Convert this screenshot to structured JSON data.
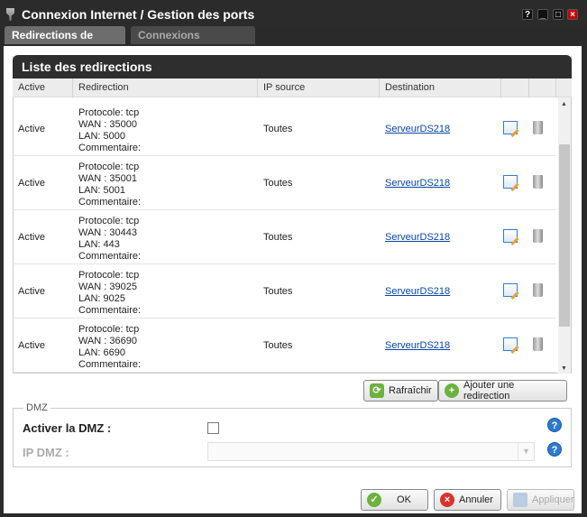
{
  "window": {
    "title": "Connexion Internet / Gestion des ports",
    "help": "?"
  },
  "tabs": [
    "Redirections de ports",
    "Connexions entrantes"
  ],
  "panel": {
    "title": "Liste des redirections",
    "columns": [
      "Active",
      "Redirection",
      "IP source",
      "Destination"
    ]
  },
  "rows": [
    {
      "active": "Active",
      "l1": "Protocole: tcp",
      "l2": "WAN : 35000",
      "l3": "LAN: 5000",
      "l4": "Commentaire:",
      "src": "Toutes",
      "dest": "ServeurDS218"
    },
    {
      "active": "Active",
      "l1": "Protocole: tcp",
      "l2": "WAN : 35001",
      "l3": "LAN: 5001",
      "l4": "Commentaire:",
      "src": "Toutes",
      "dest": "ServeurDS218"
    },
    {
      "active": "Active",
      "l1": "Protocole: tcp",
      "l2": "WAN : 30443",
      "l3": "LAN: 443",
      "l4": "Commentaire:",
      "src": "Toutes",
      "dest": "ServeurDS218"
    },
    {
      "active": "Active",
      "l1": "Protocole: tcp",
      "l2": "WAN : 39025",
      "l3": "LAN: 9025",
      "l4": "Commentaire:",
      "src": "Toutes",
      "dest": "ServeurDS218"
    },
    {
      "active": "Active",
      "l1": "Protocole: tcp",
      "l2": "WAN : 36690",
      "l3": "LAN: 6690",
      "l4": "Commentaire:",
      "src": "Toutes",
      "dest": "ServeurDS218"
    }
  ],
  "actions": {
    "refresh": "Rafraîchir",
    "add": "Ajouter une redirection"
  },
  "dmz": {
    "legend": "DMZ",
    "enable_label": "Activer la DMZ :",
    "ip_label": "IP DMZ :",
    "ip_value": ""
  },
  "footer": {
    "ok": "OK",
    "cancel": "Annuler",
    "apply": "Appliquer"
  }
}
